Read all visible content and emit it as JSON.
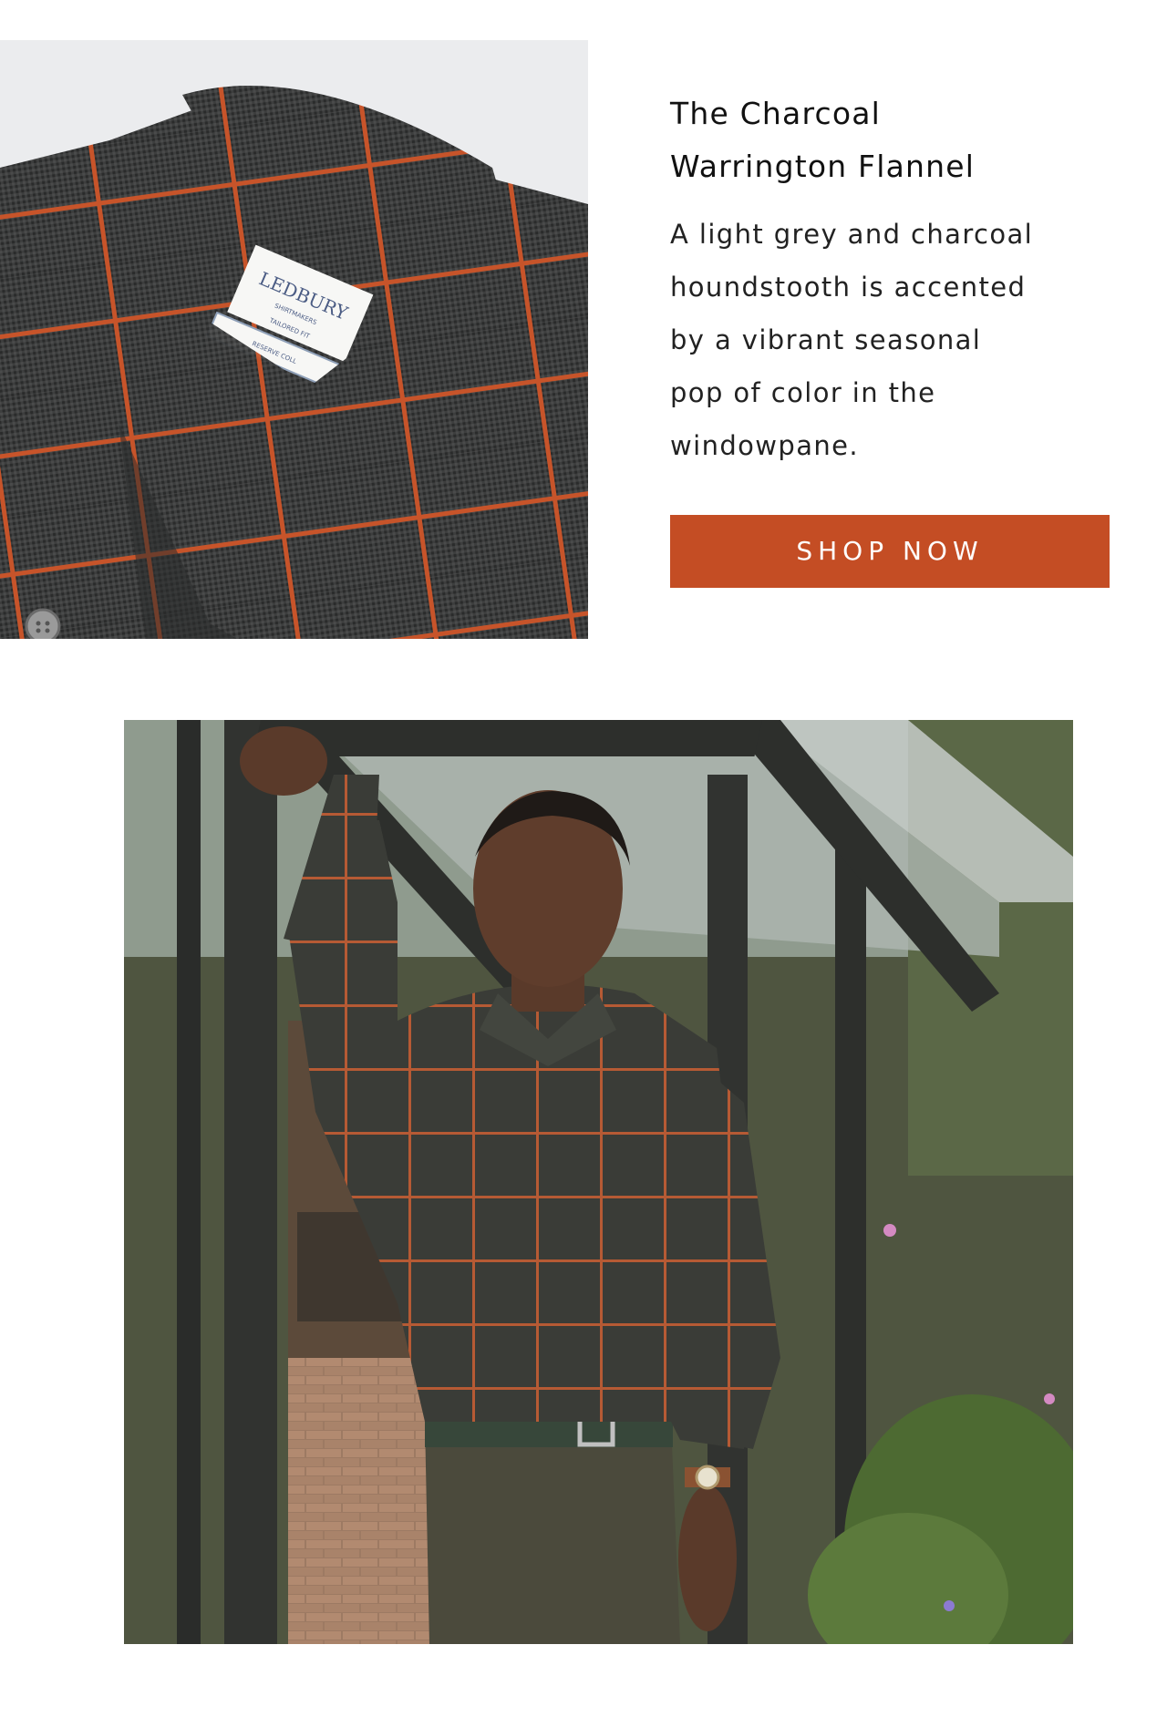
{
  "product": {
    "title_lines": [
      "The Charcoal",
      "Warrington Flannel"
    ],
    "description_lines": [
      "A light grey and charcoal",
      "houndstooth is accented",
      "by a vibrant seasonal",
      "pop of color in the",
      "windowpane."
    ],
    "cta_label": "SHOP NOW"
  },
  "shirt_label": {
    "brand": "LEDBURY",
    "line1": "SHIRTMAKERS",
    "line2": "TAILORED FIT",
    "line3": "RESERVE COLL"
  },
  "colors": {
    "cta_background": "#c44d24",
    "cta_text": "#ffffff",
    "flannel_charcoal": "#3b3c3c",
    "windowpane_orange": "#c7542a",
    "page_background": "#ffffff"
  }
}
